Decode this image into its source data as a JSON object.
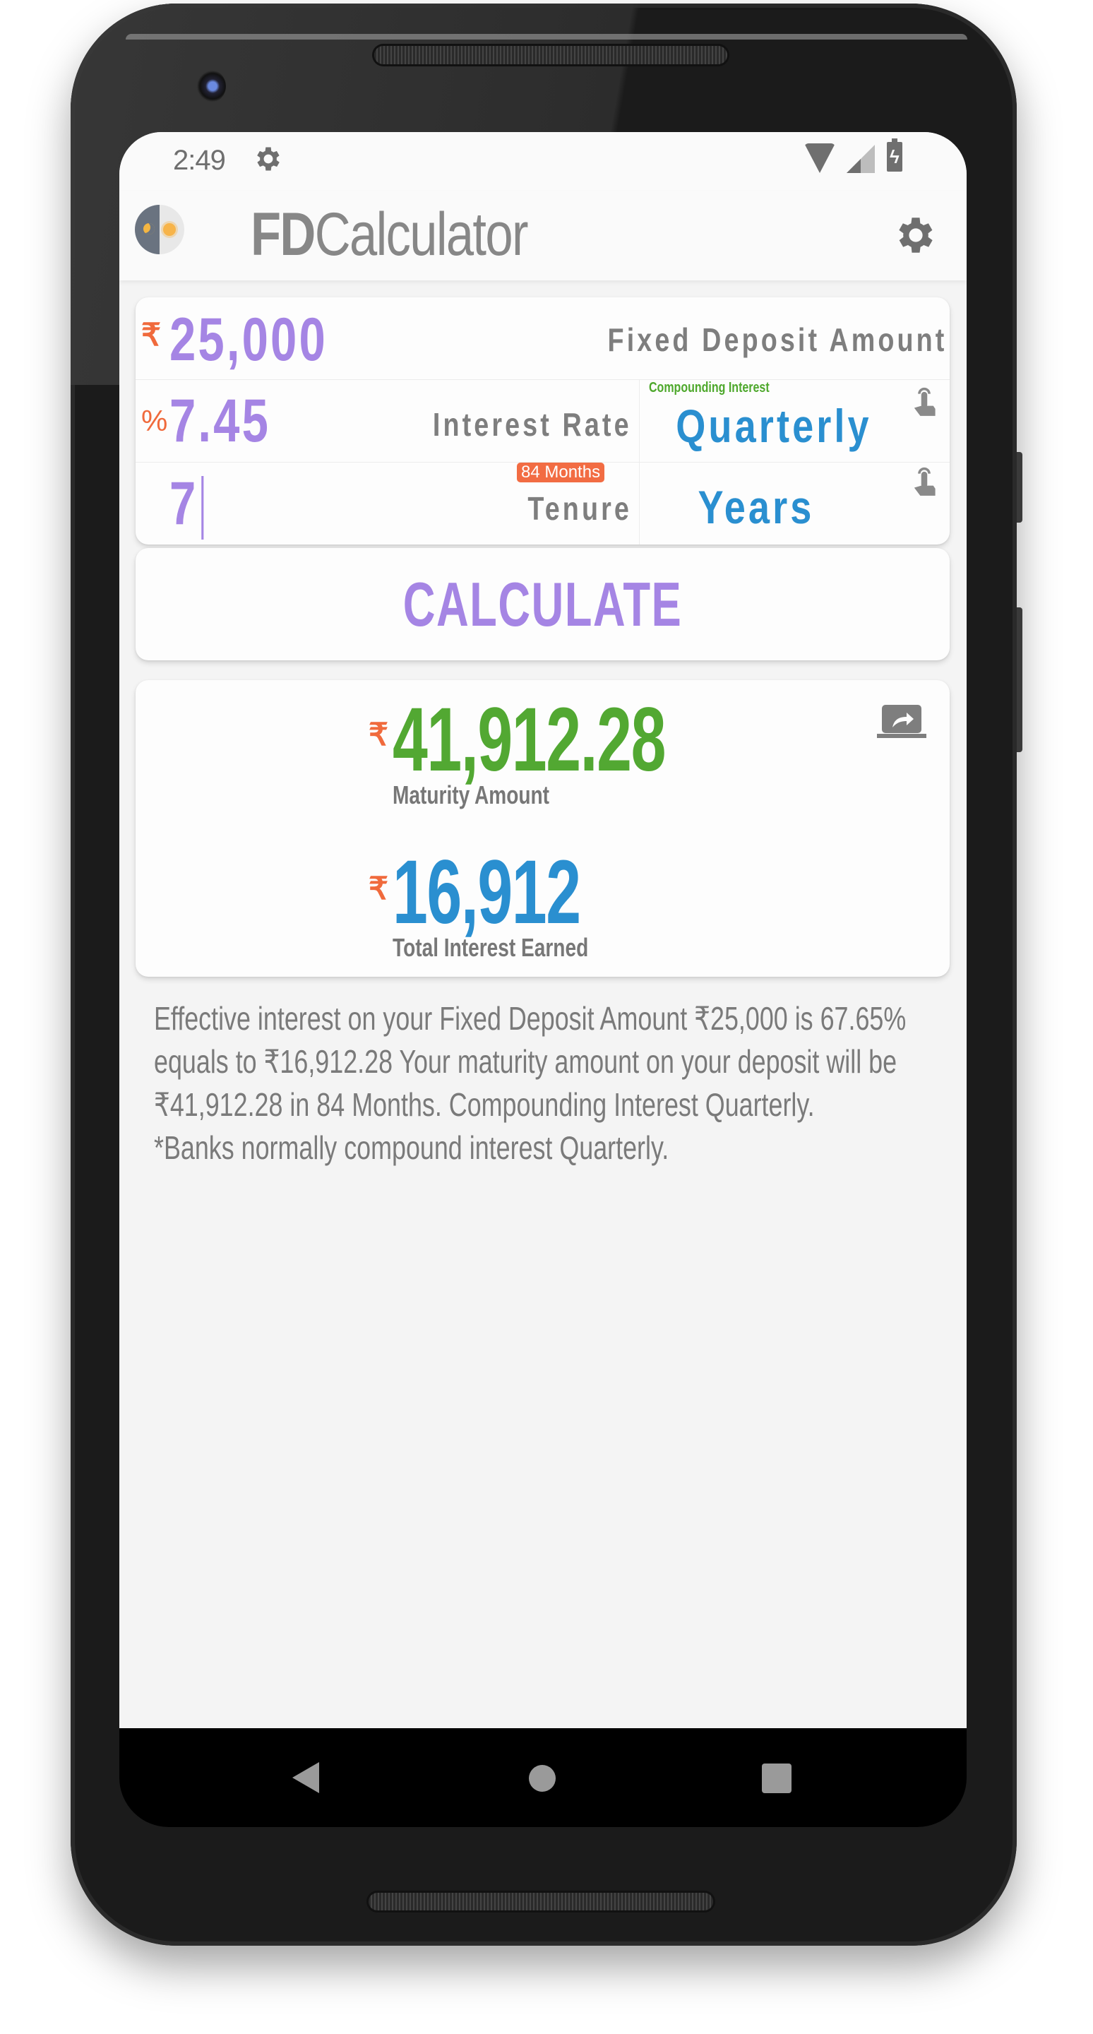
{
  "status_bar": {
    "time": "2:49",
    "icons": [
      "settings-gear-icon",
      "wifi-icon",
      "cell-signal-icon",
      "battery-charging-icon"
    ]
  },
  "app_bar": {
    "icon": "day-night-icon",
    "title_bold": "FD",
    "title_rest": "Calculator",
    "settings_icon": "gear-icon"
  },
  "inputs": {
    "amount": {
      "prefix": "₹",
      "value": "25,000",
      "label": "Fixed Deposit Amount"
    },
    "rate": {
      "prefix": "%",
      "value": "7.45",
      "label": "Interest Rate"
    },
    "compounding": {
      "caption": "Compounding Interest",
      "value": "Quarterly",
      "icon": "tap-hand-icon"
    },
    "tenure": {
      "value": "7",
      "badge": "84 Months",
      "label": "Tenure"
    },
    "tenure_unit": {
      "value": "Years",
      "icon": "tap-hand-icon"
    }
  },
  "calculate_button": {
    "label": "CALCULATE"
  },
  "results": {
    "maturity": {
      "currency": "₹",
      "value": "41,912.28",
      "caption": "Maturity Amount"
    },
    "interest": {
      "currency": "₹",
      "value": "16,912",
      "caption": "Total Interest Earned"
    },
    "share_icon": "screen-share-icon"
  },
  "summary": {
    "text": "Effective interest on your Fixed Deposit Amount ₹25,000 is 67.65% equals to ₹16,912.28 Your maturity amount on your deposit will be ₹41,912.28 in 84 Months. Compounding Interest Quarterly.",
    "note": "*Banks normally compound interest Quarterly."
  },
  "colors": {
    "input_accent": "#a585e4",
    "prefix_accent": "#f06a3c",
    "maturity_green": "#52a832",
    "interest_blue": "#2a8fd0",
    "compounding_green": "#4ea82c",
    "label_gray": "#7e7e7e"
  },
  "nav_bar": {
    "buttons": [
      "back",
      "home",
      "recents"
    ]
  }
}
